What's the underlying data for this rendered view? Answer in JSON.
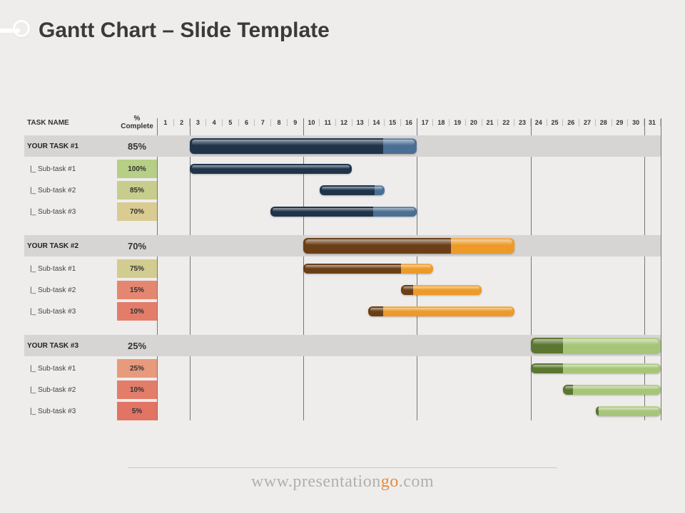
{
  "title": "Gantt Chart – Slide Template",
  "footer_pre": "www.presentation",
  "footer_accent": "go",
  "footer_post": ".com",
  "columns": {
    "task": "TASK NAME",
    "pct": "% Complete"
  },
  "timeline": {
    "days": 31,
    "major_grid_after": [
      0,
      2,
      9,
      16,
      23,
      30,
      31
    ]
  },
  "pct_color_scale": {
    "stops": [
      {
        "pct": 0,
        "color": "#e06a5e"
      },
      {
        "pct": 50,
        "color": "#f0c99b"
      },
      {
        "pct": 100,
        "color": "#b6ce85"
      }
    ]
  },
  "chart_data": {
    "type": "gantt",
    "x_unit": "day",
    "xlim": [
      1,
      31
    ],
    "groups": [
      {
        "name": "YOUR TASK #1",
        "pct": 85,
        "start": 3,
        "end": 16,
        "color_done": "#1f344a",
        "color_remain": "#4b6f93",
        "subtasks": [
          {
            "name": "|_ Sub-task #1",
            "pct": 100,
            "start": 3,
            "end": 12
          },
          {
            "name": "|_ Sub-task #2",
            "pct": 85,
            "start": 11,
            "end": 14
          },
          {
            "name": "|_ Sub-task #3",
            "pct": 70,
            "start": 8,
            "end": 16
          }
        ]
      },
      {
        "name": "YOUR TASK #2",
        "pct": 70,
        "start": 10,
        "end": 22,
        "color_done": "#6a3f17",
        "color_remain": "#ed9a28",
        "subtasks": [
          {
            "name": "|_ Sub-task #1",
            "pct": 75,
            "start": 10,
            "end": 17
          },
          {
            "name": "|_ Sub-task #2",
            "pct": 15,
            "start": 16,
            "end": 20
          },
          {
            "name": "|_ Sub-task #3",
            "pct": 10,
            "start": 14,
            "end": 22
          }
        ]
      },
      {
        "name": "YOUR TASK #3",
        "pct": 25,
        "start": 24,
        "end": 31,
        "color_done": "#5a7630",
        "color_remain": "#a7c578",
        "subtasks": [
          {
            "name": "|_ Sub-task #1",
            "pct": 25,
            "start": 24,
            "end": 31
          },
          {
            "name": "|_ Sub-task #2",
            "pct": 10,
            "start": 26,
            "end": 31
          },
          {
            "name": "|_ Sub-task #3",
            "pct": 5,
            "start": 28,
            "end": 31
          }
        ]
      }
    ]
  }
}
